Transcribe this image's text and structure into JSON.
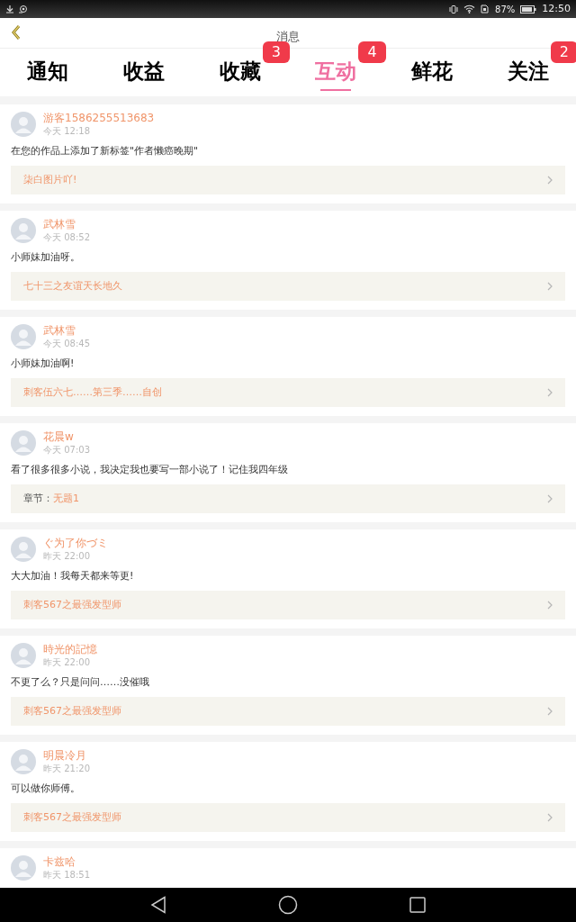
{
  "status_bar": {
    "battery": "87%",
    "time": "12:50"
  },
  "header": {
    "title": "消息"
  },
  "tabs": [
    {
      "label": "通知",
      "selected": false
    },
    {
      "label": "收益",
      "selected": false
    },
    {
      "label": "收藏",
      "selected": false,
      "badge": "3"
    },
    {
      "label": "互动",
      "selected": true,
      "badge": "4"
    },
    {
      "label": "鲜花",
      "selected": false
    },
    {
      "label": "关注",
      "selected": false,
      "badge": "2"
    }
  ],
  "messages": [
    {
      "user": "游客1586255513683",
      "time": "今天 12:18",
      "text": "在您的作品上添加了新标签\"作者懒癌晚期\"",
      "link": {
        "title": "柒白图片吖!"
      }
    },
    {
      "user": "武林雪",
      "time": "今天 08:52",
      "text": "小师妹加油呀。",
      "link": {
        "title": "七十三之友谊天长地久"
      }
    },
    {
      "user": "武林雪",
      "time": "今天 08:45",
      "text": "小师妹加油啊!",
      "link": {
        "title": "刺客伍六七……第三季……自创"
      }
    },
    {
      "user": "花晨w",
      "time": "今天 07:03",
      "text": "看了很多很多小说，我决定我也要写一部小说了！记住我四年级",
      "link": {
        "prefix": "章节：",
        "title": "无题1"
      }
    },
    {
      "user": "ぐ为了你づミ",
      "time": "昨天 22:00",
      "text": "大大加油！我每天都来等更!",
      "link": {
        "title": "刺客567之最强发型师"
      }
    },
    {
      "user": "時光的記憶",
      "time": "昨天 22:00",
      "text": "不更了么？只是问问……没催哦",
      "link": {
        "title": "刺客567之最强发型师"
      }
    },
    {
      "user": "明晨冷月",
      "time": "昨天 21:20",
      "text": "可以做你师傅。",
      "link": {
        "title": "刺客567之最强发型师"
      }
    },
    {
      "user": "卡兹哈",
      "time": "昨天 18:51"
    }
  ]
}
